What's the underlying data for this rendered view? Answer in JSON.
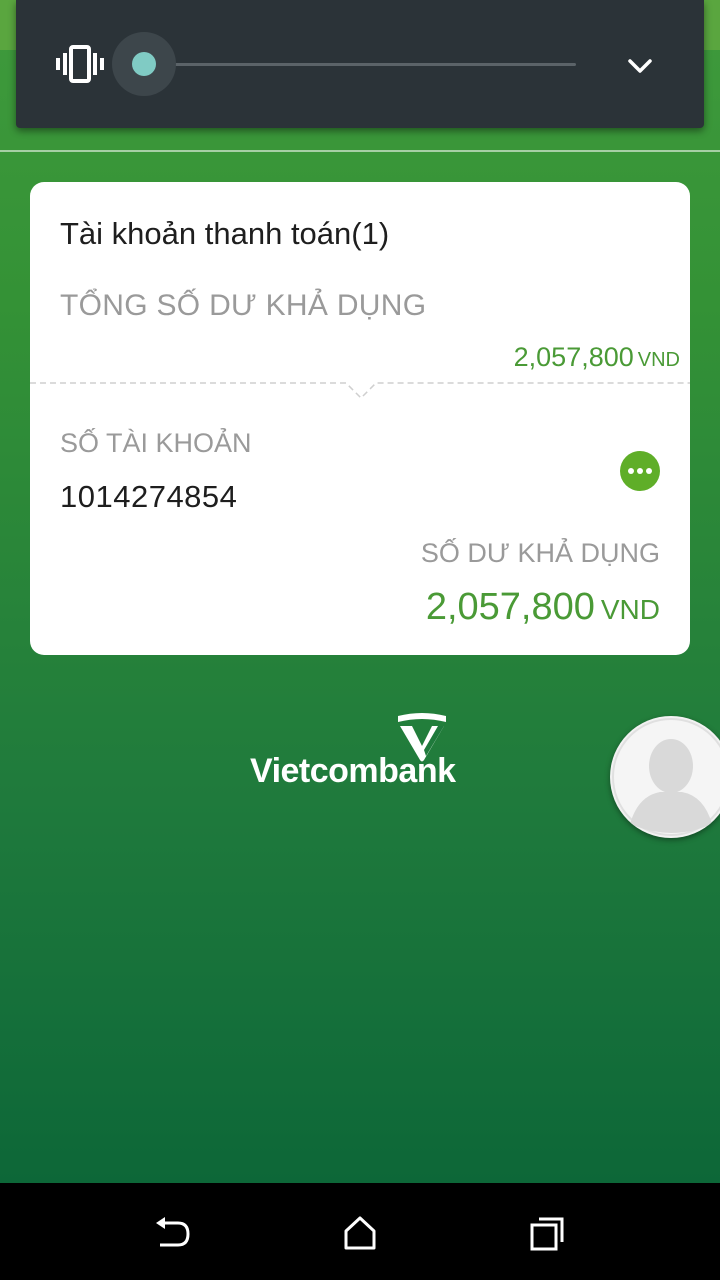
{
  "volume_panel": {
    "vibrate_icon": "vibrate-icon",
    "level": 0,
    "collapse_icon": "chevron-down-icon",
    "accent_color": "#80cbc4"
  },
  "account_card": {
    "title": "Tài khoản thanh toán(1)",
    "total_balance_label": "TỔNG SỐ DƯ KHẢ DỤNG",
    "total_balance_amount": "2,057,800",
    "total_balance_currency": "VND",
    "account_number_label": "SỐ TÀI KHOẢN",
    "account_number": "1014274854",
    "more_icon": "more-icon",
    "available_balance_label": "SỐ DƯ KHẢ DỤNG",
    "available_balance_amount": "2,057,800",
    "available_balance_currency": "VND",
    "amount_color": "#4a9a36"
  },
  "brand": {
    "name": "Vietcombank",
    "color": "#ffffff"
  },
  "avatar": {
    "icon": "user-avatar-icon"
  },
  "navbar": {
    "back_icon": "back-icon",
    "home_icon": "home-icon",
    "recents_icon": "recents-icon"
  }
}
